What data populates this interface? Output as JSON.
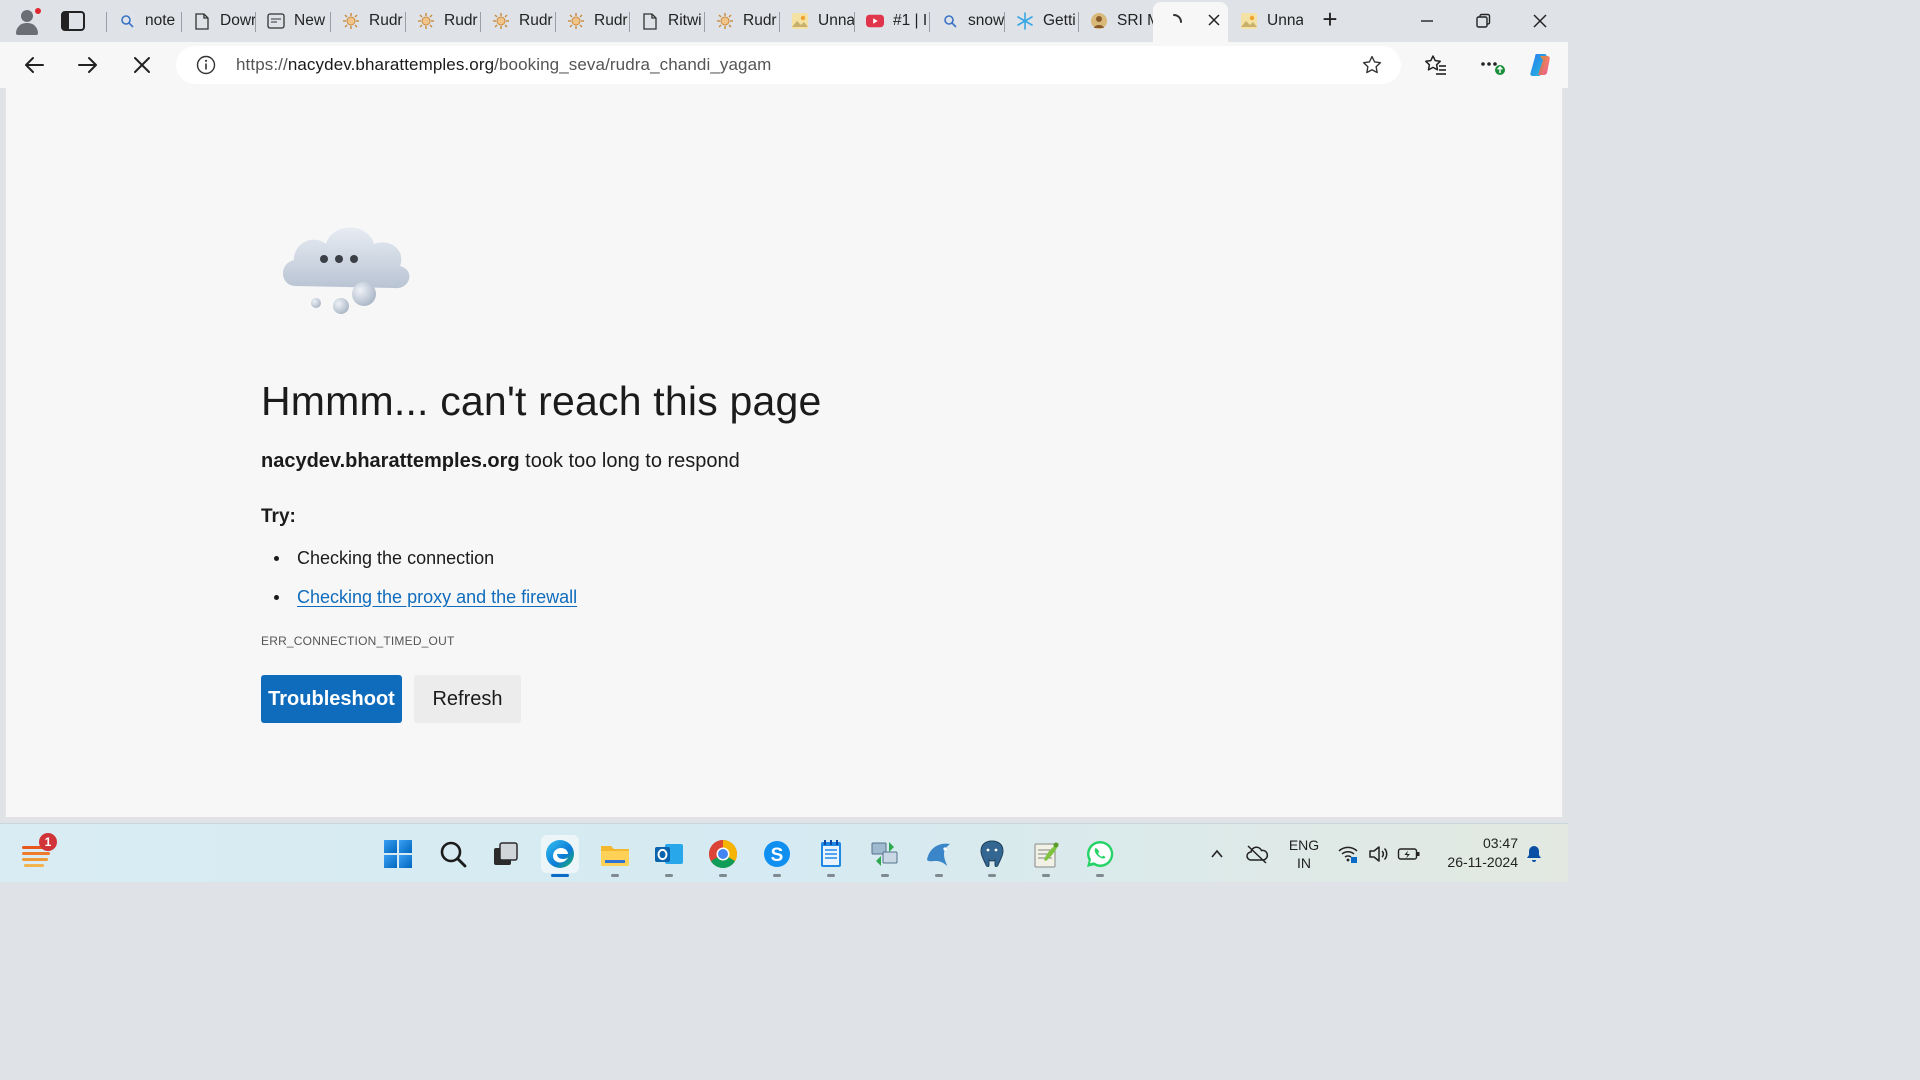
{
  "browser": {
    "tabs": [
      {
        "title": "note",
        "icon": "search-icon"
      },
      {
        "title": "Dowr",
        "icon": "page-icon"
      },
      {
        "title": "New",
        "icon": "newtab-icon"
      },
      {
        "title": "Rudr",
        "icon": "temple-icon"
      },
      {
        "title": "Rudr",
        "icon": "temple-icon"
      },
      {
        "title": "Rudr",
        "icon": "temple-icon"
      },
      {
        "title": "Rudr",
        "icon": "temple-icon"
      },
      {
        "title": "Ritwi",
        "icon": "page-icon"
      },
      {
        "title": "Rudr",
        "icon": "temple-icon"
      },
      {
        "title": "Unna",
        "icon": "image-icon"
      },
      {
        "title": "#1 | I",
        "icon": "youtube-icon"
      },
      {
        "title": "snow",
        "icon": "search-icon"
      },
      {
        "title": "Getti",
        "icon": "snowflake-icon"
      },
      {
        "title": "SRI M",
        "icon": "deity-icon"
      },
      {
        "title": "",
        "icon": "loading-icon",
        "active": true
      },
      {
        "title": "Unna",
        "icon": "image-icon"
      }
    ],
    "address": {
      "scheme": "https://",
      "host": "nacydev.bharattemples.org",
      "path": "/booking_seva/rudra_chandi_yagam"
    }
  },
  "error_page": {
    "headline": "Hmmm... can't reach this page",
    "host": "nacydev.bharattemples.org",
    "message": "took too long to respond",
    "try_label": "Try:",
    "suggestions": [
      "Checking the connection",
      "Checking the proxy and the firewall"
    ],
    "error_code": "ERR_CONNECTION_TIMED_OUT",
    "troubleshoot_label": "Troubleshoot",
    "refresh_label": "Refresh",
    "colors": {
      "primary": "#0f6cbd",
      "link": "#0f6cbd"
    }
  },
  "taskbar": {
    "widget_badge": "1",
    "apps": [
      "start-icon",
      "search-icon",
      "task-view-icon",
      "edge-icon",
      "file-explorer-icon",
      "outlook-icon",
      "chrome-icon",
      "skype-icon",
      "notepad-icon",
      "network-tool-icon",
      "dbeaver-icon",
      "postgresql-icon",
      "notepad-plus-plus-icon",
      "whatsapp-icon"
    ],
    "language": {
      "line1": "ENG",
      "line2": "IN"
    },
    "time": "03:47",
    "date": "26-11-2024"
  }
}
